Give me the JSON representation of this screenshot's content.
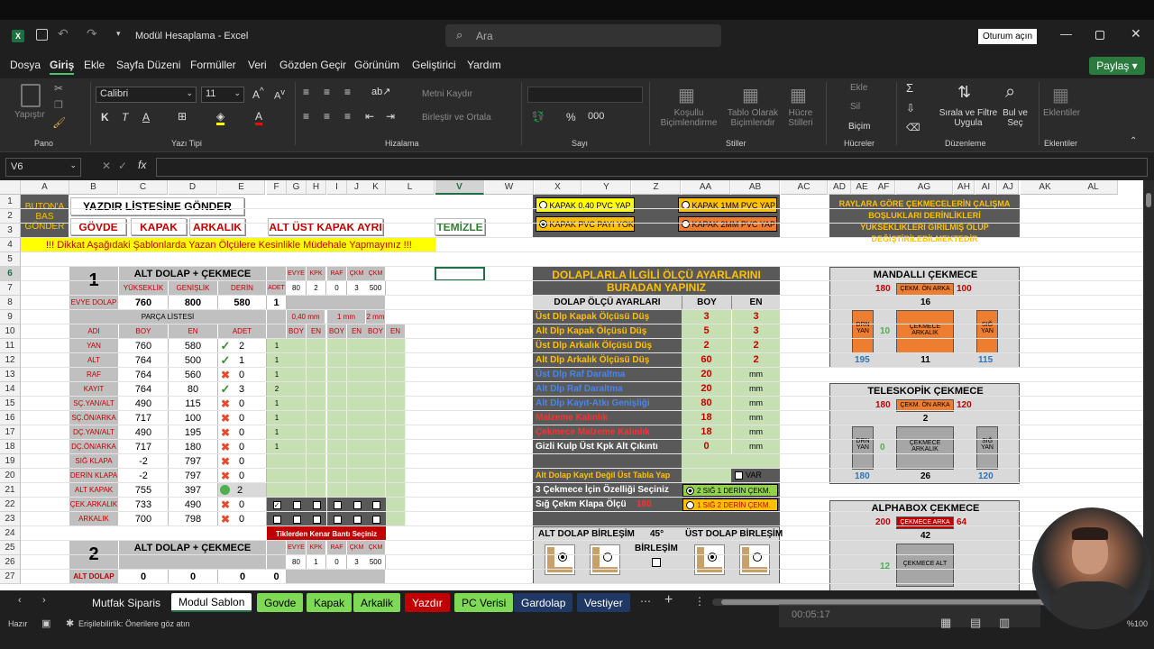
{
  "window": {
    "title": "Modül Hesaplama - Excel",
    "search": "Ara",
    "signin": "Oturum açın"
  },
  "menu": [
    "Dosya",
    "Giriş",
    "Ekle",
    "Sayfa Düzeni",
    "Formüller",
    "Veri",
    "Gözden Geçir",
    "Görünüm",
    "Geliştirici",
    "Yardım"
  ],
  "share": "Paylaş",
  "ribbon": {
    "paste": "Yapıştır",
    "font": "Calibri",
    "size": "11",
    "wrap": "Metni Kaydır",
    "merge": "Birleştir ve Ortala",
    "cond": "Koşullu Biçimlendirme",
    "table": "Tablo Olarak Biçimlendir",
    "cellstyles": "Hücre Stilleri",
    "insert": "Ekle",
    "delete": "Sil",
    "format": "Biçim",
    "sort": "Sırala ve Filtre Uygula",
    "find": "Bul ve Seç",
    "addins": "Eklentiler",
    "groups": [
      "Pano",
      "Yazı Tipi",
      "Hizalama",
      "Sayı",
      "Stiller",
      "Hücreler",
      "Düzenleme",
      "Eklentiler"
    ]
  },
  "namebox": "V6",
  "cols": [
    "A",
    "B",
    "C",
    "D",
    "E",
    "F",
    "G",
    "H",
    "I",
    "J",
    "K",
    "L",
    "V",
    "W",
    "X",
    "Y",
    "Z",
    "AA",
    "AB",
    "AC",
    "AD",
    "AE",
    "AF",
    "AG",
    "AH",
    "AI",
    "AJ",
    "AK",
    "AL"
  ],
  "rows": [
    "1",
    "2",
    "3",
    "4",
    "5",
    "6",
    "7",
    "8",
    "9",
    "10",
    "11",
    "12",
    "13",
    "14",
    "15",
    "16",
    "17",
    "18",
    "19",
    "20",
    "21",
    "22",
    "23",
    "24",
    "25",
    "26",
    "27"
  ],
  "buttons": {
    "buton_a": "BUTON'A BAS GÖNDER",
    "yazdir": "YAZDIR LİSTESİNE GÖNDER",
    "govde": "GÖVDE",
    "kapak": "KAPAK",
    "arkalik": "ARKALIK",
    "altust": "ALT ÜST KAPAK AYRI",
    "temizle": "TEMİZLE"
  },
  "warning": "!!!  Dikkat Aşağıdaki Şablonlarda Yazan Ölçülere Kesinlikle Müdehale Yapmayınız  !!!",
  "mod1": {
    "num": "1",
    "title": "ALT DOLAP + ÇEKMECE",
    "h_yuk": "YÜKSEKLİK",
    "h_gen": "GENİŞLİK",
    "h_der": "DERİN",
    "h_adet": "ADET",
    "evye_lbl": "EVYE DOLAP",
    "evye_yuk": "760",
    "evye_gen": "800",
    "evye_der": "580",
    "evye_adet": "1",
    "parca": "PARÇA LİSTESİ",
    "c_adi": "ADI",
    "c_boy": "BOY",
    "c_en": "EN",
    "c_adet": "ADET",
    "small_hdr": [
      "EVYE",
      "KPK",
      "RAF",
      "ÇKM",
      "ÇKM"
    ],
    "small_vals": [
      "80",
      "2",
      "0",
      "3",
      "500"
    ],
    "mm": [
      "0,40 mm",
      "1 mm",
      "2 mm"
    ],
    "be": [
      "BOY",
      "EN",
      "BOY",
      "EN",
      "BOY",
      "EN"
    ],
    "parts": [
      {
        "name": "YAN",
        "boy": "760",
        "en": "580",
        "adet": "2",
        "f": "1"
      },
      {
        "name": "ALT",
        "boy": "764",
        "en": "500",
        "adet": "1",
        "f": "1"
      },
      {
        "name": "RAF",
        "boy": "764",
        "en": "560",
        "adet": "0",
        "f": "1"
      },
      {
        "name": "KAYIT",
        "boy": "764",
        "en": "80",
        "adet": "3",
        "f": "2"
      },
      {
        "name": "SÇ.YAN/ALT",
        "boy": "490",
        "en": "115",
        "adet": "0",
        "f": "1"
      },
      {
        "name": "SÇ.ÖN/ARKA",
        "boy": "717",
        "en": "100",
        "adet": "0",
        "f": "1"
      },
      {
        "name": "DÇ.YAN/ALT",
        "boy": "490",
        "en": "195",
        "adet": "0",
        "f": "1"
      },
      {
        "name": "DÇ.ÖN/ARKA",
        "boy": "717",
        "en": "180",
        "adet": "0",
        "f": "1"
      },
      {
        "name": "SIĞ KLAPA",
        "boy": "-2",
        "en": "797",
        "adet": "0",
        "f": ""
      },
      {
        "name": "DERİN KLAPA",
        "boy": "-2",
        "en": "797",
        "adet": "0",
        "f": ""
      },
      {
        "name": "ALT KAPAK",
        "boy": "755",
        "en": "397",
        "adet": "2",
        "f": ""
      },
      {
        "name": "ÇEK.ARKALIK",
        "boy": "733",
        "en": "490",
        "adet": "0",
        "f": ""
      },
      {
        "name": "ARKALIK",
        "boy": "700",
        "en": "798",
        "adet": "0",
        "f": ""
      }
    ],
    "kenar": "Tiklerden Kenar Bantı Seçiniz"
  },
  "mod2": {
    "num": "2",
    "title": "ALT DOLAP + ÇEKMECE",
    "small_hdr": [
      "EVYE",
      "KPK",
      "RAF",
      "ÇKM",
      "ÇKM"
    ],
    "small_vals": [
      "80",
      "1",
      "0",
      "3",
      "500"
    ],
    "lbl": "ALT DOLAP",
    "vals": [
      "0",
      "0",
      "0",
      "0"
    ]
  },
  "options": {
    "kapak040": "KAPAK 0,40 PVC YAP",
    "kapakyok": "KAPAK PVC PAYI YOK",
    "kapak1": "KAPAK 1MM PVC YAP",
    "kapak2": "KAPAK 2MM PVC YAP"
  },
  "note": "RAYLARA GÖRE ÇEKMECELERİN ÇALIŞMA BOŞLUKLARI DERİNLİKLERİ YÜKSEKLİKLERİ GİRİLMİŞ OLUP DEĞİŞTİRİLEBİLMEKTEDİR",
  "settings": {
    "title": "DOLAPLARLA İLGİLİ ÖLÇÜ AYARLARINI BURADAN YAPINIZ",
    "h1": "DOLAP ÖLÇÜ AYARLARI",
    "h2": "BOY",
    "h3": "EN",
    "rows": [
      {
        "label": "Üst Dlp Kapak Ölçüsü Düş",
        "boy": "3",
        "en": "3",
        "c": "y"
      },
      {
        "label": "Alt Dlp Kapak Ölçüsü Düş",
        "boy": "5",
        "en": "3",
        "c": "y"
      },
      {
        "label": "Üst Dlp Arkalık Ölçüsü Düş",
        "boy": "2",
        "en": "2",
        "c": "y"
      },
      {
        "label": "Alt Dlp Arkalık Ölçüsü Düş",
        "boy": "60",
        "en": "2",
        "c": "y"
      },
      {
        "label": "Üst Dlp Raf Daraltma",
        "boy": "20",
        "en": "mm",
        "c": "b"
      },
      {
        "label": "Alt Dlp Raf Daraltma",
        "boy": "20",
        "en": "mm",
        "c": "b"
      },
      {
        "label": "Alt Dlp Kayıt-Atkı Genişliği",
        "boy": "80",
        "en": "mm",
        "c": "b"
      },
      {
        "label": "Malzeme Kalınlık",
        "boy": "18",
        "en": "mm",
        "c": "r"
      },
      {
        "label": "Çekmece Malzeme Kalınlık",
        "boy": "18",
        "en": "mm",
        "c": "r"
      },
      {
        "label": "Gizli Kulp Üst Kpk Alt Çıkıntı",
        "boy": "0",
        "en": "mm",
        "c": "w"
      }
    ],
    "kayit": "Alt Dolap Kayıt Değil Üst Tabla Yap",
    "var": "VAR",
    "cekmece": "3 Çekmece İçin Özelliği Seçiniz",
    "opt1": "2 SIĞ 1 DERİN ÇEKM.",
    "sig": "Sığ Çekm Klapa Ölçü",
    "sigval": "180",
    "opt2": "1 SIĞ 2 DERİN ÇEKM.",
    "altbir": "ALT DOLAP BİRLEŞİM",
    "deg": "45°",
    "birlesim": "BİRLEŞİM",
    "ustbir": "ÜST DOLAP BİRLEŞİM"
  },
  "mandal": {
    "title": "MANDALLI ÇEKMECE",
    "v1": "180",
    "lbl": "ÇEKM. ÖN ARKA",
    "v2": "100",
    "v3": "16",
    "drn": "DRN YAN",
    "mid": "10",
    "ark": "ÇEKMECE ARKALIK",
    "sig": "SIĞ YAN",
    "b1": "195",
    "b2": "11",
    "b3": "115"
  },
  "teles": {
    "title": "TELESKOPİK ÇEKMECE",
    "v1": "180",
    "lbl": "ÇEKM. ÖN ARKA",
    "v2": "120",
    "v3": "2",
    "drn": "DRN YAN",
    "mid": "0",
    "ark": "ÇEKMECE ARKALIK",
    "sig": "SIĞ YAN",
    "b1": "180",
    "b2": "26",
    "b3": "120"
  },
  "alpha": {
    "title": "ALPHABOX ÇEKMECE",
    "v1": "200",
    "lbl": "ÇEKMECE ARKA",
    "v2": "64",
    "v3": "42",
    "mid": "12",
    "alt": "ÇEKMECE ALT"
  },
  "sheets": [
    "Mutfak Siparis",
    "Modul Sablon",
    "Govde",
    "Kapak",
    "Arkalik",
    "Yazdır",
    "PC Verisi",
    "Gardolap",
    "Vestiyer"
  ],
  "status": {
    "ready": "Hazır",
    "access": "Erişilebilirlik: Önerilere göz atın",
    "zoom": "%100",
    "time": "00:05:17"
  }
}
